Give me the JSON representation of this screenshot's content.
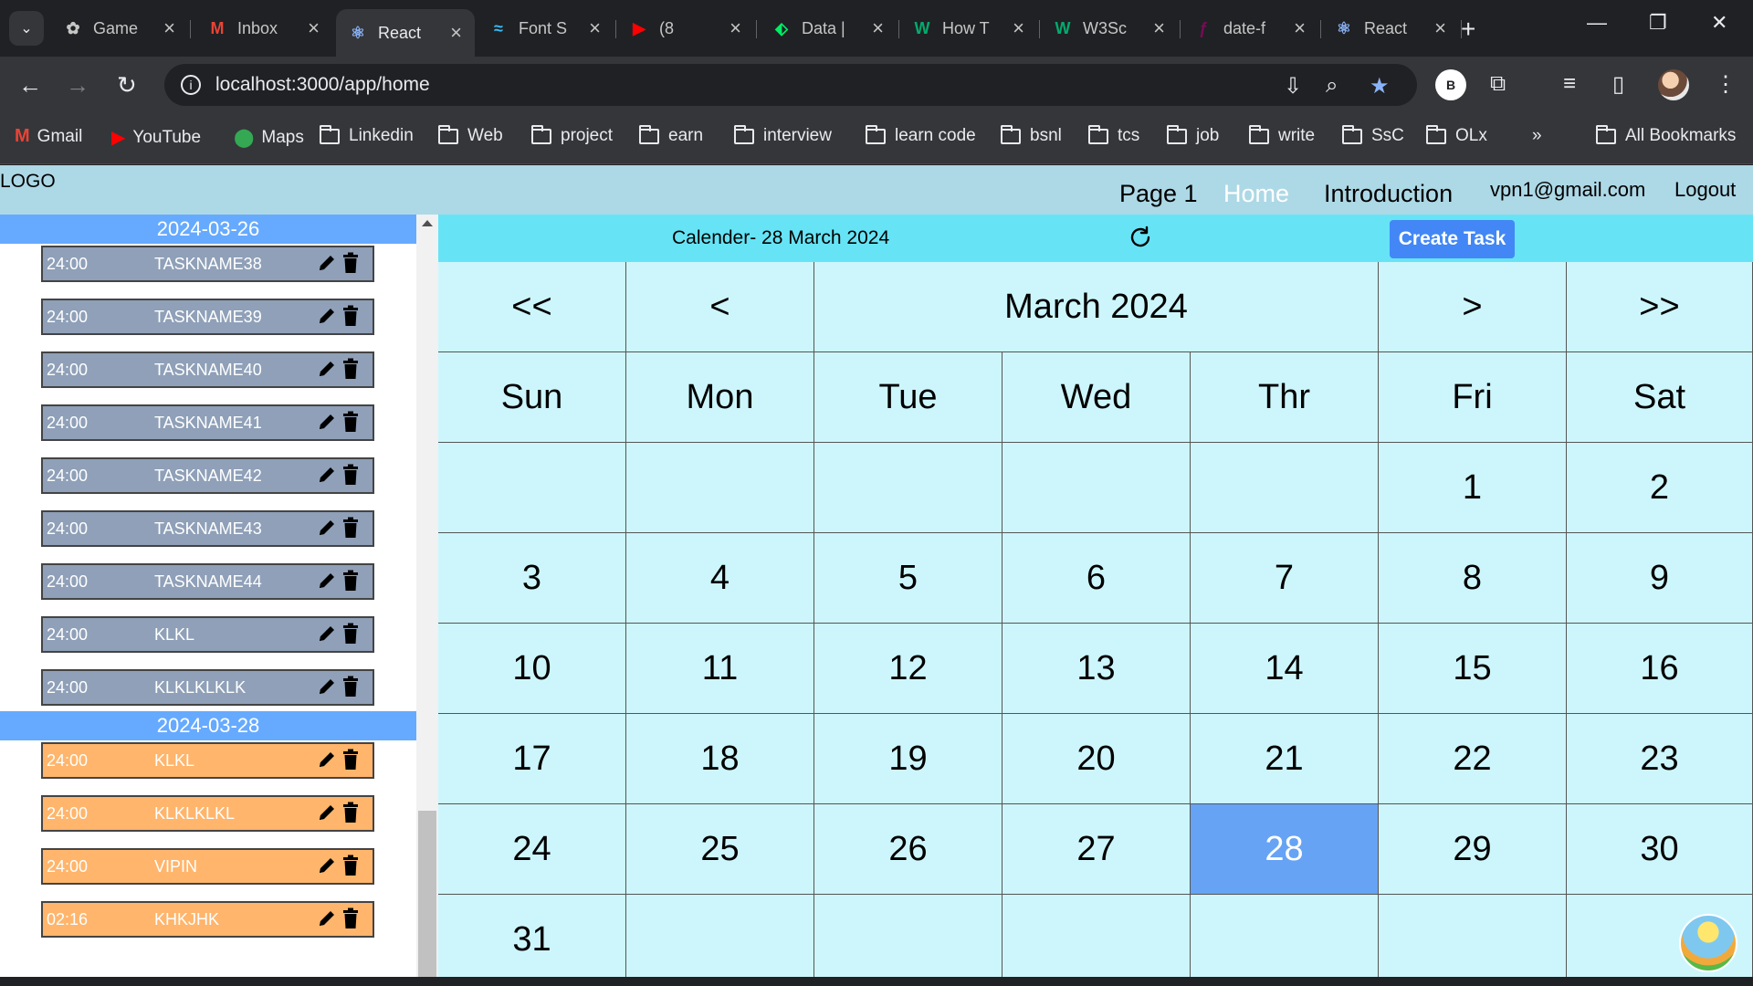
{
  "browser": {
    "tabs": [
      {
        "title": "Game",
        "icon": "chatgpt-icon"
      },
      {
        "title": "Inbox",
        "icon": "gmail-icon"
      },
      {
        "title": "React",
        "icon": "react-icon"
      },
      {
        "title": "Font S",
        "icon": "tailwind-icon"
      },
      {
        "title": "(8",
        "icon": "youtube-icon"
      },
      {
        "title": "Data |",
        "icon": "mongodb-icon"
      },
      {
        "title": "How T",
        "icon": "w3schools-icon"
      },
      {
        "title": "W3Sc",
        "icon": "w3schools-icon"
      },
      {
        "title": "date-f",
        "icon": "date-fns-icon"
      },
      {
        "title": "React",
        "icon": "react-icon"
      }
    ],
    "url": "localhost:3000/app/home",
    "profile_letter": "B",
    "bookmarks": [
      "Gmail",
      "YouTube",
      "Maps",
      "Linkedin",
      "Web",
      "project",
      "earn",
      "interview",
      "learn code",
      "bsnl",
      "tcs",
      "job",
      "write",
      "SsC",
      "OLx"
    ],
    "all_bookmarks": "All Bookmarks"
  },
  "app": {
    "logo": "LOGO",
    "nav": {
      "page1": "Page 1",
      "home": "Home",
      "intro": "Introduction",
      "email": "vpn1@gmail.com",
      "logout": "Logout"
    },
    "colors": {
      "header": "#add8e6",
      "date_header": "#66aaff",
      "task_gray": "#8fa0b8",
      "task_orange": "#ffb56b",
      "calendar_bg": "#cdf6fc",
      "today": "#66a3f5",
      "create_btn": "#4287f5"
    }
  },
  "sidebar": {
    "groups": [
      {
        "date": "2024-03-26",
        "tasks": [
          {
            "time": "24:00",
            "name": "TASKNAME38"
          },
          {
            "time": "24:00",
            "name": "TASKNAME39"
          },
          {
            "time": "24:00",
            "name": "TASKNAME40"
          },
          {
            "time": "24:00",
            "name": "TASKNAME41"
          },
          {
            "time": "24:00",
            "name": "TASKNAME42"
          },
          {
            "time": "24:00",
            "name": "TASKNAME43"
          },
          {
            "time": "24:00",
            "name": "TASKNAME44"
          },
          {
            "time": "24:00",
            "name": "KLKL"
          },
          {
            "time": "24:00",
            "name": "KLKLKLKLK"
          }
        ]
      },
      {
        "date": "2024-03-28",
        "tasks": [
          {
            "time": "24:00",
            "name": "KLKL"
          },
          {
            "time": "24:00",
            "name": "KLKLKLKL"
          },
          {
            "time": "24:00",
            "name": "VIPIN"
          },
          {
            "time": "02:16",
            "name": "KHKJHK"
          }
        ]
      }
    ]
  },
  "calendar": {
    "title": "Calender- 28 March 2024",
    "create_task": "Create Task",
    "nav": {
      "prev_year": "<<",
      "prev_month": "<",
      "month_label": "March 2024",
      "next_month": ">",
      "next_year": ">>"
    },
    "weekdays": [
      "Sun",
      "Mon",
      "Tue",
      "Wed",
      "Thr",
      "Fri",
      "Sat"
    ],
    "weeks": [
      [
        "",
        "",
        "",
        "",
        "",
        "1",
        "2"
      ],
      [
        "3",
        "4",
        "5",
        "6",
        "7",
        "8",
        "9"
      ],
      [
        "10",
        "11",
        "12",
        "13",
        "14",
        "15",
        "16"
      ],
      [
        "17",
        "18",
        "19",
        "20",
        "21",
        "22",
        "23"
      ],
      [
        "24",
        "25",
        "26",
        "27",
        "28",
        "29",
        "30"
      ],
      [
        "31",
        "",
        "",
        "",
        "",
        "",
        ""
      ]
    ],
    "today": "28"
  }
}
